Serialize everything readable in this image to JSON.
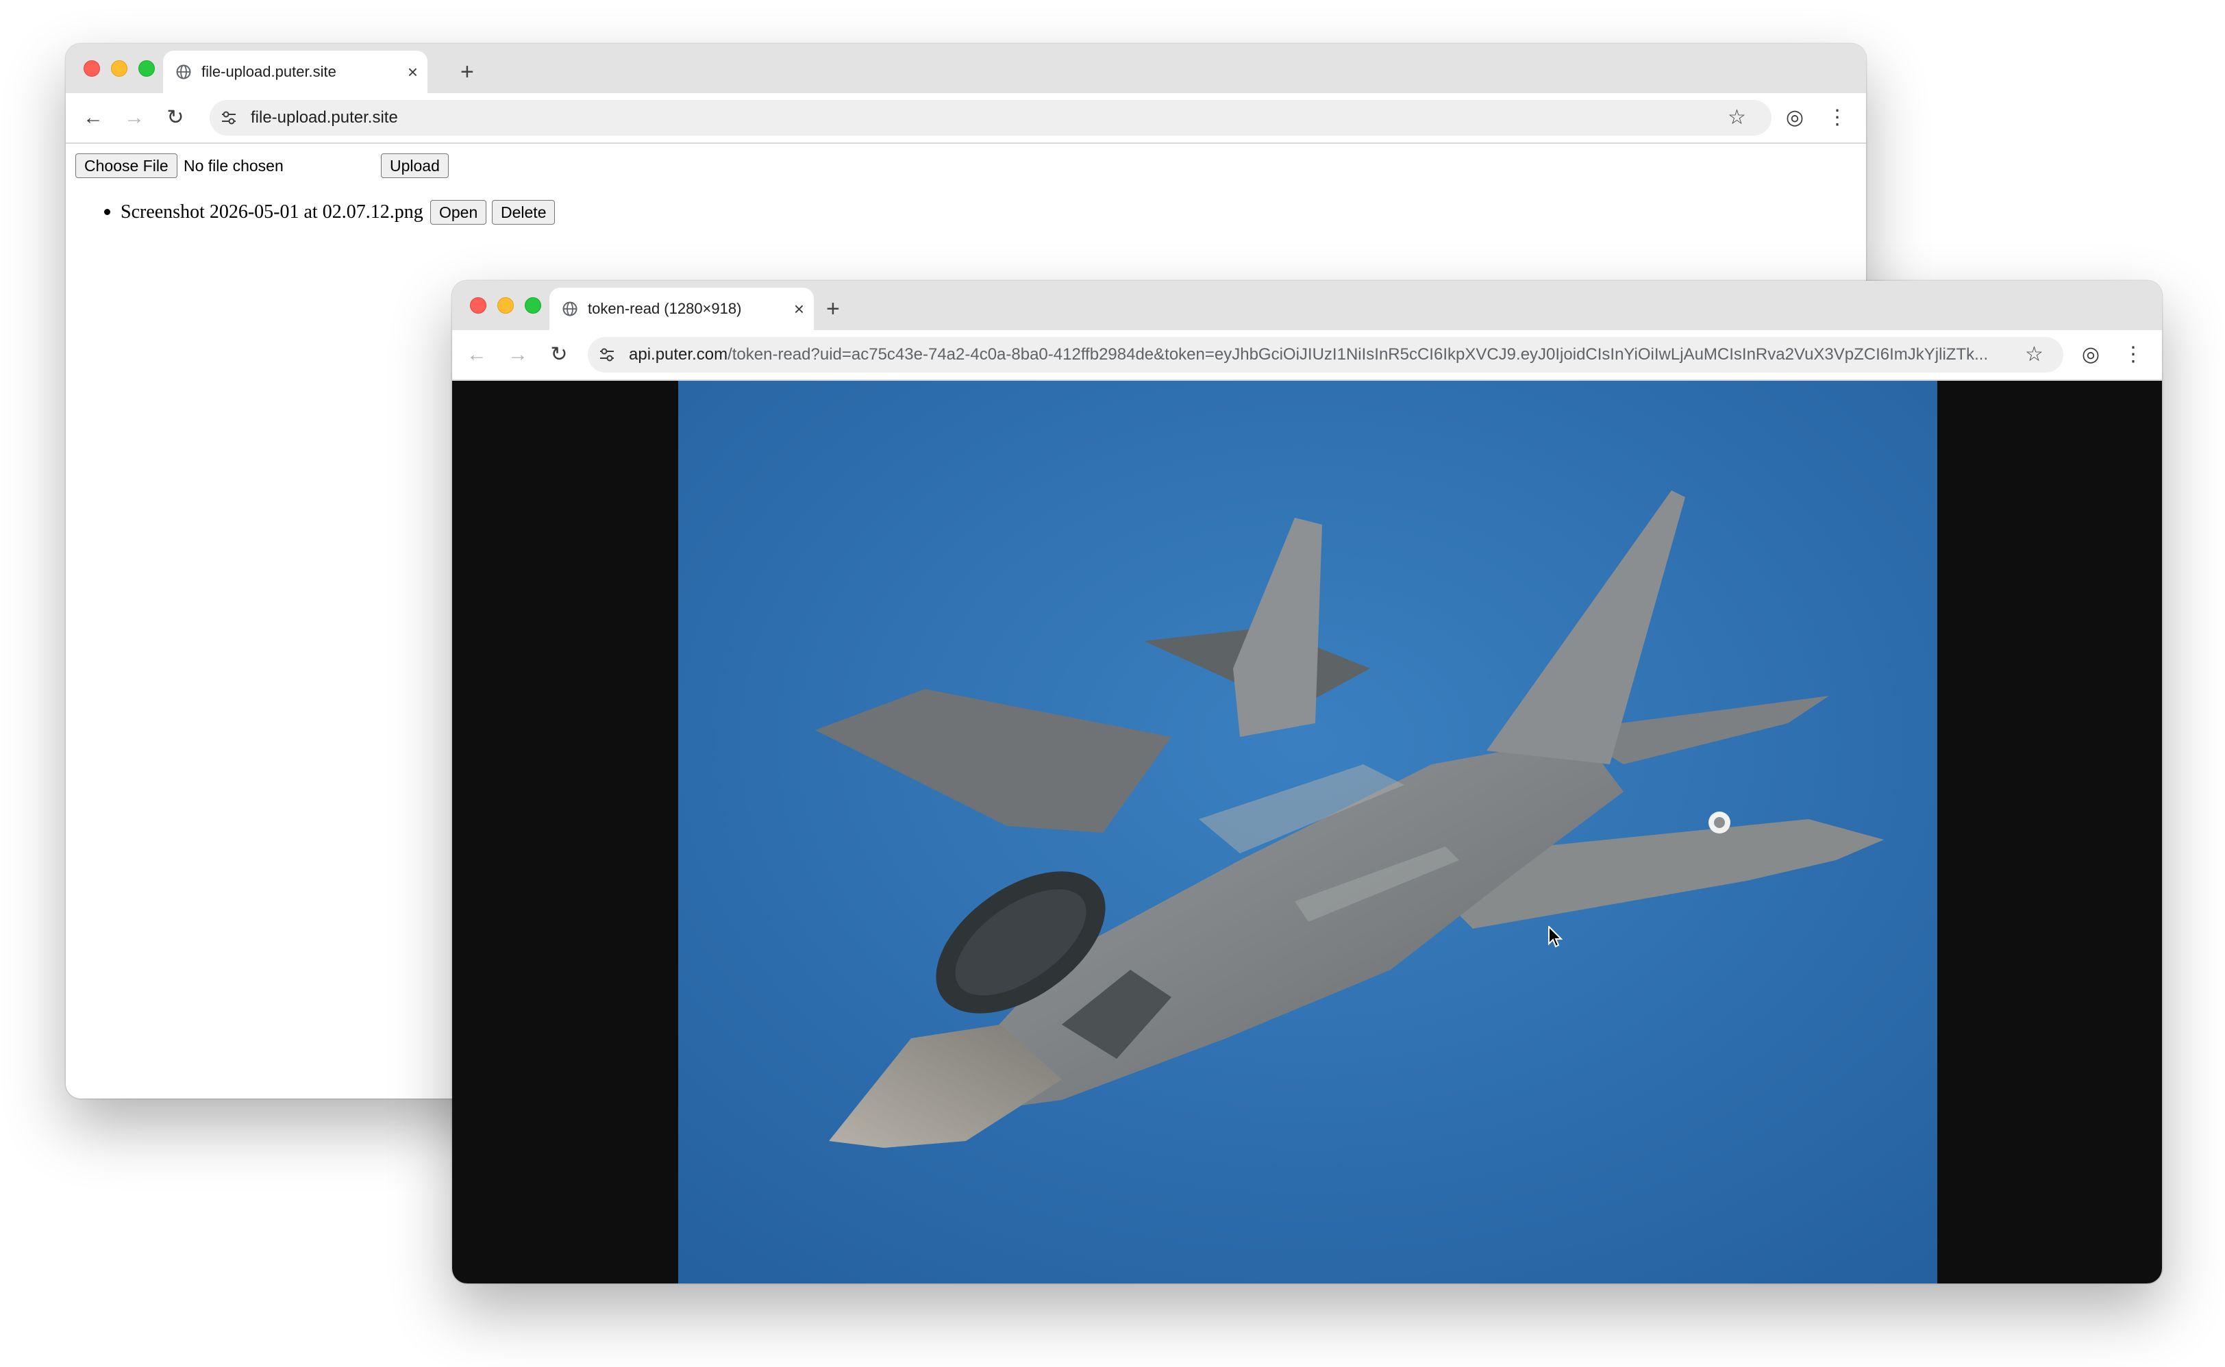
{
  "window_back": {
    "tab_title": "file-upload.puter.site",
    "tab_close": "×",
    "new_tab": "+",
    "url": "file-upload.puter.site",
    "page": {
      "choose_file_label": "Choose File",
      "no_file_text": "No file chosen",
      "upload_label": "Upload",
      "files": [
        {
          "name": "Screenshot 2026-05-01 at 02.07.12.png",
          "open_label": "Open",
          "delete_label": "Delete"
        }
      ]
    }
  },
  "window_front": {
    "tab_title": "token-read (1280×918)",
    "tab_close": "×",
    "new_tab": "+",
    "url_host": "api.puter.com",
    "url_path": "/token-read?uid=ac75c43e-74a2-4c0a-8ba0-412ffb2984de&token=eyJhbGciOiJIUzI1NiIsInR5cCI6IkpXVCJ9.eyJ0IjoidCIsInYiOiIwLjAuMCIsInRva2VuX3VpZCI6ImJkYjliZTk...",
    "image_subject": "F-35 fighter jet in flight over blue sky",
    "colors": {
      "sky": "#2f6fae",
      "letterbox": "#0e0e0e",
      "aircraft": "#7f8384"
    }
  }
}
